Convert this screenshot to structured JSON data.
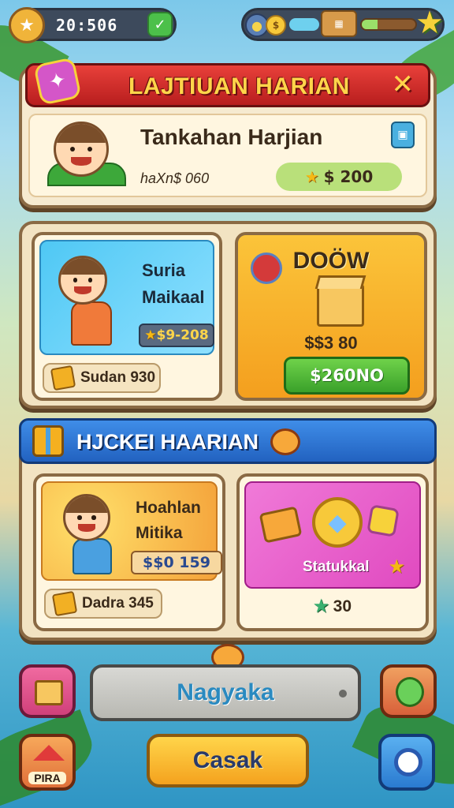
{
  "hud": {
    "time": "20:506"
  },
  "daily_panel": {
    "title": "LAJTIUAN HARIAN",
    "close": "✕",
    "card_title": "Tankahan Harjian",
    "sub": "haXn$ 060",
    "reward": "$ 200"
  },
  "offers": {
    "card1_name": "Suria Maikaal",
    "card1_price": "$9-208",
    "card1_footer": "Sudan 930",
    "card2_title": "DOÖW",
    "card2_price": "$$3 80",
    "card2_button": "$260NO"
  },
  "hadiah_panel": {
    "title": "HJCKEI HAARIAN",
    "card1_name": "Hoahlan Mitika",
    "card1_price": "$$0 159",
    "card1_footer": "Dadra 345",
    "card2_label": "Statukkal",
    "card2_value": "30"
  },
  "bottom": {
    "center_label": "Nagyaka",
    "home_label": "PIRA",
    "main_button": "Casak"
  },
  "hud_progress": 0.3,
  "colors": {
    "accent_red": "#e8403a",
    "accent_blue": "#3f8de8",
    "accent_yellow": "#ffd54a",
    "accent_green": "#3aa12a"
  }
}
